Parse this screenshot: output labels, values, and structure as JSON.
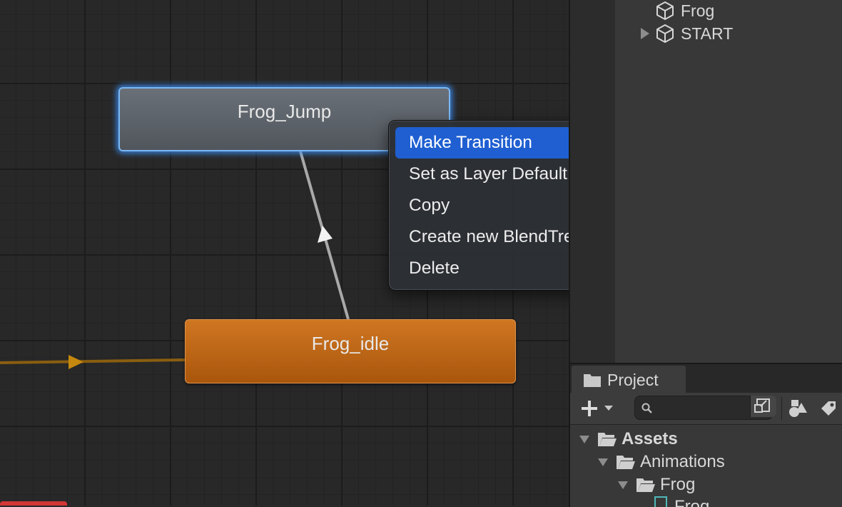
{
  "graph": {
    "states": [
      {
        "name": "Frog_Jump",
        "kind": "selected"
      },
      {
        "name": "Frog_idle",
        "kind": "default"
      }
    ],
    "colors": {
      "default_state": "#c86c1a",
      "selected_outline": "#4a9cf5",
      "transition": "#a8a8a8",
      "entry_transition": "#9a6a10"
    }
  },
  "context_menu": {
    "items": [
      {
        "label": "Make Transition",
        "selected": true
      },
      {
        "label": "Set as Layer Default State",
        "selected": false
      },
      {
        "label": "Copy",
        "selected": false
      },
      {
        "label": "Create new BlendTree in State",
        "selected": false
      },
      {
        "label": "Delete",
        "selected": false
      }
    ],
    "highlight_color": "#1f5fd1"
  },
  "hierarchy": {
    "items": [
      {
        "label": "Frog",
        "icon": "gameobject-cube-icon",
        "expandable": false
      },
      {
        "label": "START",
        "icon": "gameobject-cube-icon",
        "expandable": true
      }
    ]
  },
  "project": {
    "tab_label": "Project",
    "search": {
      "value": "",
      "placeholder": ""
    },
    "tree": [
      {
        "label": "Assets",
        "bold": true
      },
      {
        "label": "Animations",
        "bold": false
      },
      {
        "label": "Frog",
        "bold": false
      },
      {
        "label": "Frog",
        "bold": false
      }
    ]
  }
}
